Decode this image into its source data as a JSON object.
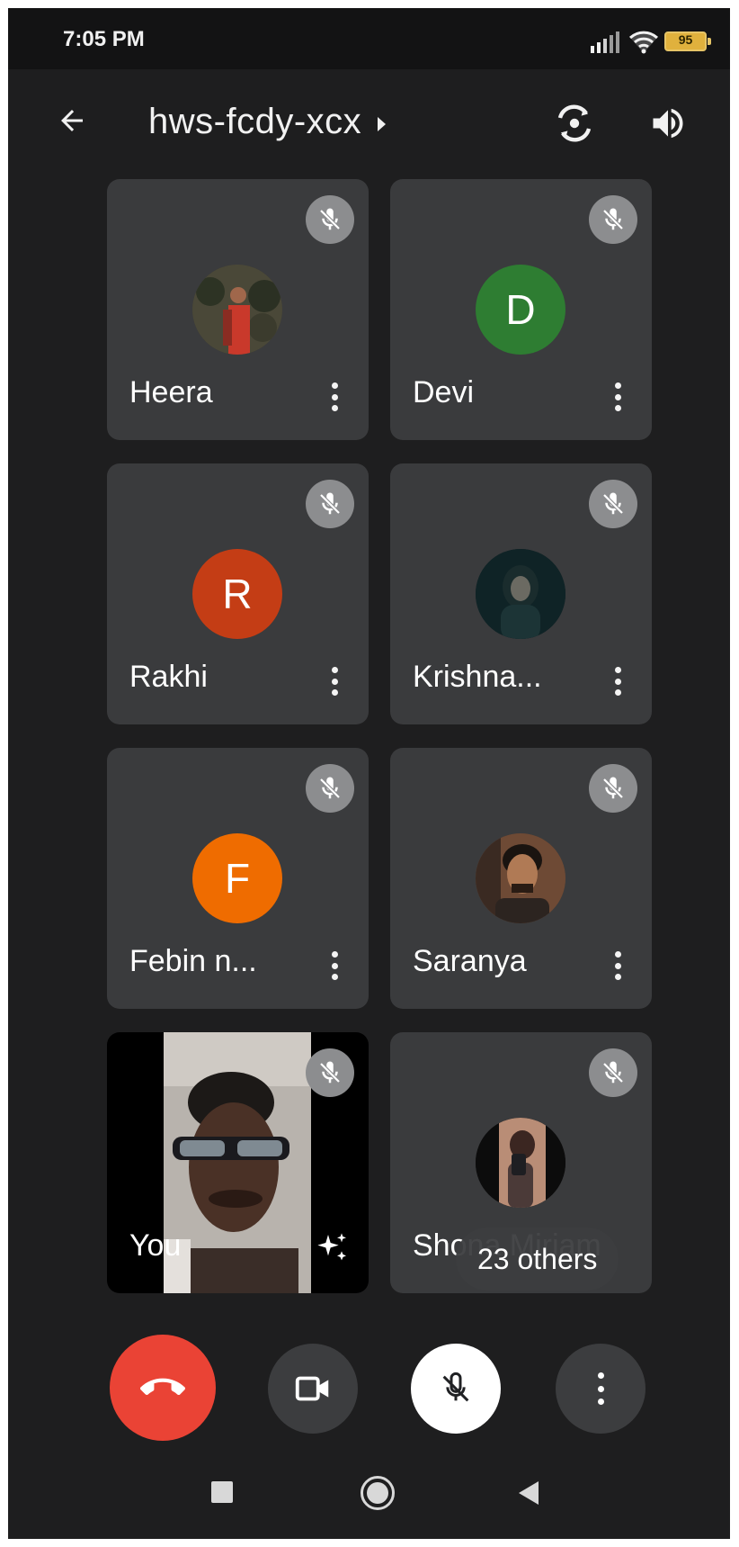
{
  "status_bar": {
    "time": "7:05 PM",
    "battery": "95"
  },
  "header": {
    "meeting_code": "hws-fcdy-xcx"
  },
  "participants": [
    {
      "name": "Heera",
      "avatar": "photo",
      "muted": true
    },
    {
      "name": "Devi",
      "avatar_letter": "D",
      "avatar_color": "#2e7d32",
      "muted": true
    },
    {
      "name": "Rakhi",
      "avatar_letter": "R",
      "avatar_color": "#c43d15",
      "muted": true
    },
    {
      "name": "Krishna...",
      "avatar": "photo",
      "muted": true
    },
    {
      "name": "Febin n...",
      "avatar_letter": "F",
      "avatar_color": "#ef6c00",
      "muted": true
    },
    {
      "name": "Saranya",
      "avatar": "photo",
      "muted": true
    },
    {
      "name": "You",
      "video": "self-camera",
      "muted": true
    },
    {
      "name": "Shona Miriam",
      "avatar": "photo",
      "muted": true
    }
  ],
  "others_chip": "23 others",
  "controls": {
    "end_call": "phone-hangup-icon",
    "camera": "video-camera-icon",
    "mic": "mic-off-icon",
    "more": "more-vertical-icon"
  },
  "colors": {
    "background": "#1e1e1f",
    "tile": "#3a3b3d",
    "end_call": "#ea4335",
    "mute_badge": "#8c8d8f"
  }
}
